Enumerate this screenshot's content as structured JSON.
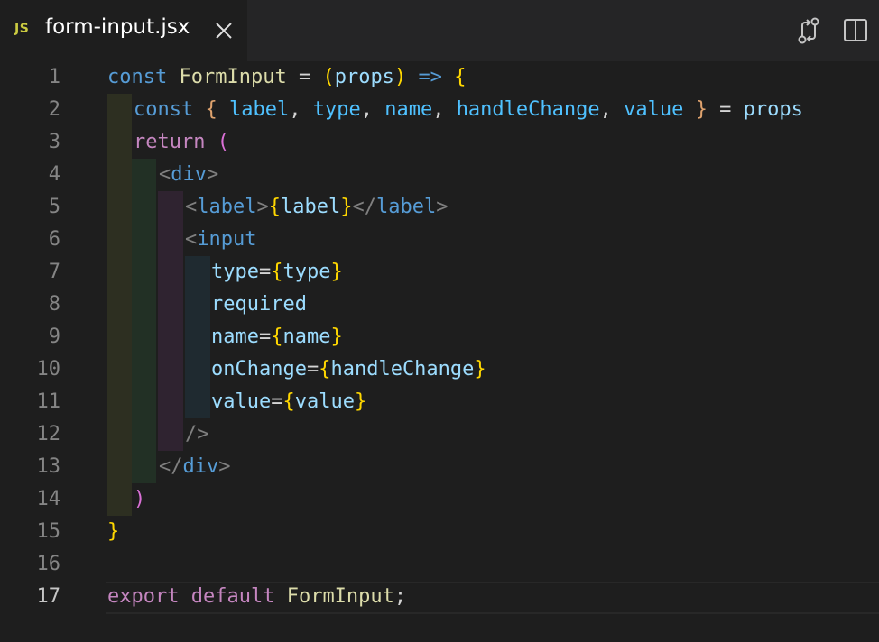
{
  "tab": {
    "language_badge": "JS",
    "file_name": "form-input.jsx"
  },
  "toolbar": {
    "compare_icon": "open-changes-icon",
    "split_icon": "split-editor-icon"
  },
  "editor": {
    "active_line": "17",
    "line_numbers": [
      "1",
      "2",
      "3",
      "4",
      "5",
      "6",
      "7",
      "8",
      "9",
      "10",
      "11",
      "12",
      "13",
      "14",
      "15",
      "16",
      "17"
    ],
    "lines": {
      "l1": [
        "const",
        " ",
        "FormInput",
        " ",
        "=",
        " ",
        "(",
        "props",
        ")",
        " ",
        "=>",
        " ",
        "{"
      ],
      "l2": [
        "const",
        " ",
        "{",
        " ",
        "label",
        ",",
        " ",
        "type",
        ",",
        " ",
        "name",
        ",",
        " ",
        "handleChange",
        ",",
        " ",
        "value",
        " ",
        "}",
        " ",
        "=",
        " ",
        "props"
      ],
      "l3": [
        "return",
        " ",
        "("
      ],
      "l4": [
        "<",
        "div",
        ">"
      ],
      "l5": [
        "<",
        "label",
        ">",
        "{",
        "label",
        "}",
        "</",
        "label",
        ">"
      ],
      "l6": [
        "<",
        "input"
      ],
      "l7": [
        "type",
        "=",
        "{",
        "type",
        "}"
      ],
      "l8": [
        "required"
      ],
      "l9": [
        "name",
        "=",
        "{",
        "name",
        "}"
      ],
      "l10": [
        "onChange",
        "=",
        "{",
        "handleChange",
        "}"
      ],
      "l11": [
        "value",
        "=",
        "{",
        "value",
        "}"
      ],
      "l12": [
        "/>"
      ],
      "l13": [
        "</",
        "div",
        ">"
      ],
      "l14": [
        ")"
      ],
      "l15": [
        "}"
      ],
      "l16": [],
      "l17": [
        "export",
        " ",
        "default",
        " ",
        "FormInput",
        ";"
      ]
    }
  },
  "colors": {
    "background": "#1e1e1e",
    "tab_bar": "#252526",
    "keyword": "#569cd6",
    "control_keyword": "#c586c0",
    "function": "#dcdcaa",
    "variable": "#9cdcfe",
    "bracket_level1": "#ffd700",
    "bracket_level2": "#da70d6",
    "bracket_level3": "#179fff",
    "js_badge": "#cbcb41"
  }
}
